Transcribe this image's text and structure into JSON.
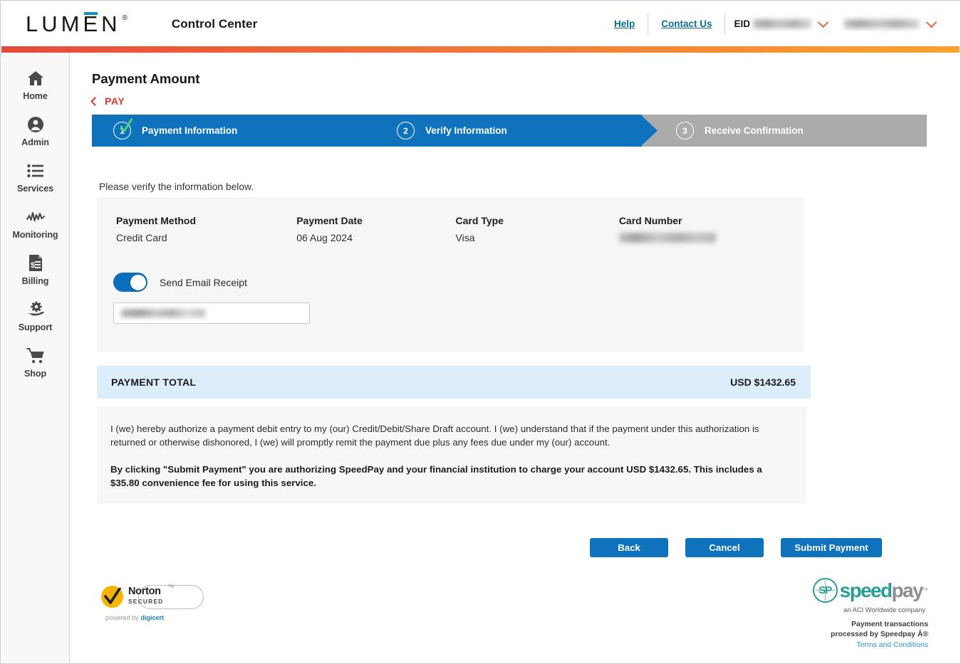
{
  "header": {
    "brand": "LUMEN",
    "brand_reg": "®",
    "app_title": "Control Center",
    "help_label": "Help",
    "contact_label": "Contact Us",
    "eid_label": "EID",
    "eid_value": "",
    "account_value": ""
  },
  "sidebar": {
    "items": [
      {
        "label": "Home",
        "icon": "home-icon"
      },
      {
        "label": "Admin",
        "icon": "user-circle-icon"
      },
      {
        "label": "Services",
        "icon": "list-icon"
      },
      {
        "label": "Monitoring",
        "icon": "activity-icon"
      },
      {
        "label": "Billing",
        "icon": "invoice-icon"
      },
      {
        "label": "Support",
        "icon": "support-gear-hand-icon"
      },
      {
        "label": "Shop",
        "icon": "cart-icon"
      }
    ]
  },
  "page": {
    "title": "Payment Amount",
    "breadcrumb": "PAY"
  },
  "stepper": {
    "steps": [
      {
        "number": "1",
        "label": "Payment Information",
        "state": "complete"
      },
      {
        "number": "2",
        "label": "Verify Information",
        "state": "active"
      },
      {
        "number": "3",
        "label": "Receive Confirmation",
        "state": "inactive"
      }
    ]
  },
  "verify": {
    "note": "Please verify the information below.",
    "fields": [
      {
        "label": "Payment Method",
        "value": "Credit Card"
      },
      {
        "label": "Payment Date",
        "value": "06 Aug 2024"
      },
      {
        "label": "Card Type",
        "value": "Visa"
      },
      {
        "label": "Card Number",
        "value": ""
      }
    ],
    "email_receipt_label": "Send Email Receipt",
    "email_receipt_on": true,
    "email_value": "",
    "email_placeholder": ""
  },
  "total": {
    "label": "PAYMENT TOTAL",
    "value": "USD $1432.65"
  },
  "authorization": {
    "paragraph_1": "I (we) hereby authorize a payment debit entry to my (our) Credit/Debit/Share Draft account. I (we) understand that if the payment under this authorization is returned or otherwise dishonored, I (we) will promptly remit the payment due plus any fees due under my (our) account.",
    "paragraph_2": "By clicking \"Submit Payment\" you are authorizing SpeedPay and your financial institution to charge your account USD $1432.65. This includes a $35.80 convenience fee for using this service."
  },
  "actions": {
    "back": "Back",
    "cancel": "Cancel",
    "submit": "Submit Payment"
  },
  "footer": {
    "norton_word_1": "Norton",
    "norton_word_2": "SECURED",
    "norton_tm": "TM",
    "norton_powered": "powered by",
    "norton_digicert": "digicert",
    "speedpay_mark": "SP",
    "speedpay_word_1": "speed",
    "speedpay_word_2": "pay",
    "speedpay_tm": "™",
    "speedpay_tagline": "an ACI Worldwide company",
    "speedpay_processed_line1": "Payment transactions",
    "speedpay_processed_line2": "processed by Speedpay Â®",
    "speedpay_terms": "Terms and Conditions"
  },
  "colors": {
    "accent_blue": "#0f72bc",
    "accent_red": "#e0382a",
    "accent_orange": "#f9a42f",
    "step_inactive": "#aaabad",
    "total_bg": "#ddeefb"
  }
}
